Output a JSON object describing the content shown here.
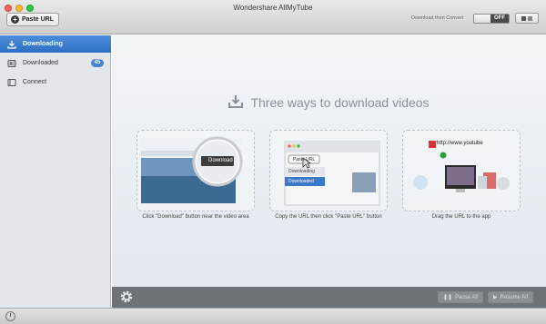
{
  "window": {
    "title": "Wondershare AllMyTube"
  },
  "toolbar": {
    "paste_url_label": "Paste URL",
    "download_then_convert_label": "Download then Convert",
    "toggle_state": "OFF"
  },
  "sidebar": {
    "items": [
      {
        "label": "Downloading",
        "icon": "download-icon",
        "active": true
      },
      {
        "label": "Downloaded",
        "icon": "film-icon",
        "badge": "45"
      },
      {
        "label": "Connect",
        "icon": "device-icon"
      }
    ]
  },
  "main": {
    "headline": "Three ways to download videos",
    "cards": [
      {
        "caption": "Click \"Download\" button near the video area",
        "inset_button": "Download"
      },
      {
        "caption": "Copy the URL then click \"Paste URL\" button",
        "inset_button": "Paste URL",
        "inset_rows": [
          "Downloading",
          "Downloaded"
        ]
      },
      {
        "caption": "Drag the URL to the app",
        "url_text": "http://www.youtube"
      }
    ]
  },
  "bottombar": {
    "pause_all_label": "Pause All",
    "resume_all_label": "Resume All"
  },
  "colors": {
    "accent": "#2d6fc4",
    "toolbar_dark": "#6e7378"
  }
}
